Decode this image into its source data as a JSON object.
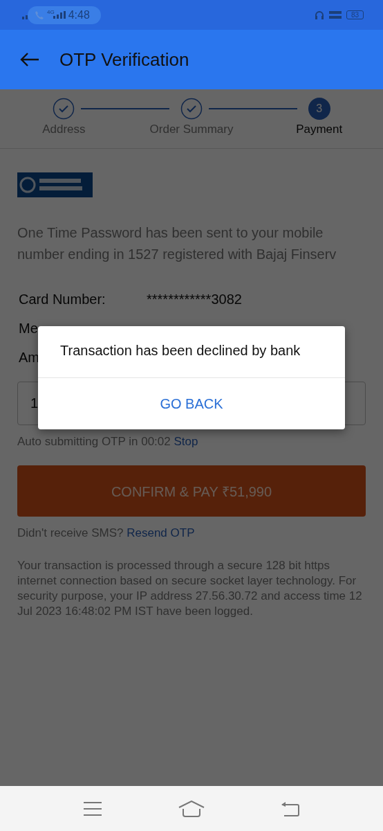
{
  "status_bar": {
    "network": "4G",
    "time": "4:48",
    "battery": "83"
  },
  "header": {
    "title": "OTP Verification"
  },
  "steps": [
    {
      "label": "Address",
      "completed": true,
      "selected": false
    },
    {
      "label": "Order Summary",
      "completed": true,
      "selected": false
    },
    {
      "label": "Payment",
      "completed": false,
      "selected": true,
      "number": "3"
    }
  ],
  "message": "One Time Password has been sent to your mobile number ending in 1527 registered with Bajaj Finserv",
  "details": [
    {
      "label": "Card Number:",
      "value": "************3082"
    },
    {
      "label": "Me"
    },
    {
      "label": "Am"
    }
  ],
  "otp_field": {
    "value": "1"
  },
  "auto_submit": {
    "text": "Auto submitting OTP in 00:02",
    "link": "Stop"
  },
  "confirm_button": "CONFIRM & PAY ₹51,990",
  "resend": {
    "text": "Didn't receive SMS?",
    "link": "Resend OTP"
  },
  "disclaimer": "Your transaction is processed through a secure 128 bit https internet connection based on secure socket layer technology. For security purpose, your IP address 27.56.30.72 and access time 12 Jul 2023 16:48:02 PM IST have been logged.",
  "dialog": {
    "message": "Transaction has been declined by bank",
    "button": "GO BACK"
  }
}
